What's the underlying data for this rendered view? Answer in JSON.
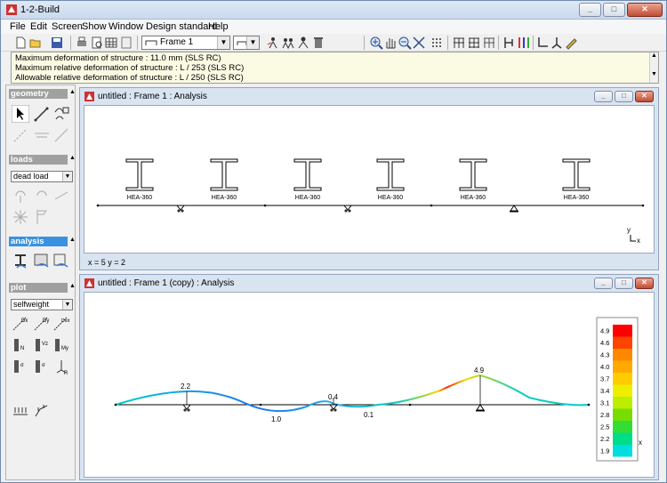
{
  "window": {
    "title": "1-2-Build"
  },
  "menu": [
    "File",
    "Edit",
    "Screen",
    "Show",
    "Window",
    "Design standard",
    "Help"
  ],
  "toolbar": {
    "frame_select": "Frame 1"
  },
  "messages": [
    "Maximum deformation of structure : 11.0 mm (SLS RC)",
    "Maximum relative deformation of structure : L / 253 (SLS RC)",
    "Allowable relative deformation of structure : L / 250 (SLS RC)"
  ],
  "panel": {
    "geometry": "geometry",
    "loads": "loads",
    "loads_select": "dead load",
    "analysis": "analysis",
    "plot": "plot",
    "plot_select": "selfweight"
  },
  "window1": {
    "title": "untitled : Frame 1 : Analysis",
    "section_labels": [
      "HEA-360",
      "HEA-360",
      "HEA-360",
      "HEA-360",
      "HEA-360",
      "HEA-360"
    ],
    "axis_y": "y",
    "axis_x": "x",
    "status": "x = 5 y = 2"
  },
  "window2": {
    "title": "untitled : Frame 1 (copy) : Analysis",
    "value_labels": [
      "2.2",
      "1.0",
      "0.4",
      "0.1",
      "4.9"
    ],
    "legend_values": [
      "4.9",
      "4.6",
      "4.3",
      "4.0",
      "3.7",
      "3.4",
      "3.1",
      "2.8",
      "2.5",
      "2.2",
      "1.9"
    ],
    "legend_colors": [
      "#ff0000",
      "#ff4400",
      "#ff8800",
      "#ffaa00",
      "#ffcc00",
      "#eeee00",
      "#bbee00",
      "#77dd00",
      "#33dd33",
      "#00dd88",
      "#00dddd"
    ],
    "legend_axis": "x"
  },
  "colors": {
    "accent": "#3a91e0",
    "deformation_low": "#1f6fe8",
    "deformation_high": "#ff2200"
  }
}
